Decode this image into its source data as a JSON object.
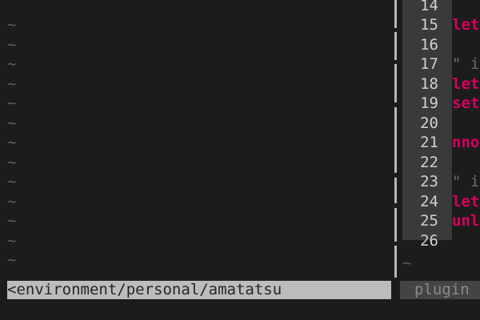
{
  "editor": {
    "left_window": {
      "filler": "~",
      "status": "<environment/personal/amatatsu"
    },
    "right_window": {
      "lines": [
        {
          "number": "14",
          "text": "",
          "kind": "code"
        },
        {
          "number": "15",
          "text": "let",
          "kind": "code"
        },
        {
          "number": "16",
          "text": "",
          "kind": "code"
        },
        {
          "number": "17",
          "text": "\" i",
          "kind": "comment"
        },
        {
          "number": "18",
          "text": "let",
          "kind": "code"
        },
        {
          "number": "19",
          "text": "set",
          "kind": "code"
        },
        {
          "number": "20",
          "text": "",
          "kind": "code"
        },
        {
          "number": "21",
          "text": "nno",
          "kind": "code"
        },
        {
          "number": "22",
          "text": "",
          "kind": "code"
        },
        {
          "number": "23",
          "text": "\" i",
          "kind": "comment"
        },
        {
          "number": "24",
          "text": "let",
          "kind": "code"
        },
        {
          "number": "25",
          "text": "unl",
          "kind": "code"
        },
        {
          "number": "26",
          "text": "",
          "kind": "code"
        }
      ],
      "filler": "~",
      "status": "plugin"
    }
  },
  "colors": {
    "background": "#1c1c1c",
    "keyword": "#d7005f",
    "comment": "#6c6c6c",
    "gutter": "#3a3a3a",
    "status_active": "#bcbcbc",
    "status_inactive": "#444444"
  }
}
